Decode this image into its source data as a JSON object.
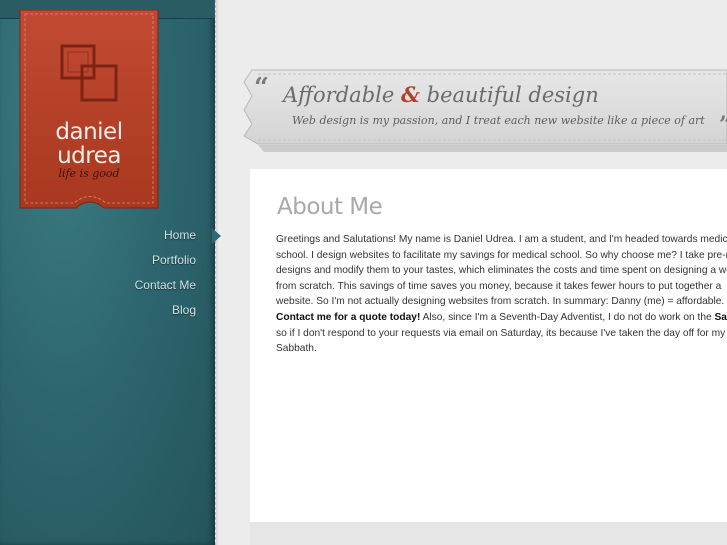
{
  "logo": {
    "name_line1": "daniel",
    "name_line2": "udrea",
    "tagline": "life is good",
    "ribbon_color": "#b9402a"
  },
  "nav": {
    "items": [
      {
        "label": "Home",
        "active": true
      },
      {
        "label": "Portfolio",
        "active": false
      },
      {
        "label": "Contact Me",
        "active": false
      },
      {
        "label": "Blog",
        "active": false
      }
    ]
  },
  "banner": {
    "open_quote": "“",
    "close_quote": "”",
    "title_part1": "Affordable",
    "title_amp": "&",
    "title_part2": "beautiful design",
    "subtitle": "Web design is my passion, and I treat each new website like a piece of art",
    "accent_color": "#b0412a"
  },
  "main": {
    "heading": "About Me",
    "lines": [
      [
        "Greetings and Salutations! My name is Daniel Udrea. I am a student, and I'm headed towards medical"
      ],
      [
        "school. I design websites to facilitate my savings for medical school. So why choose me? I take pre-made"
      ],
      [
        "designs and modify them to your tastes, which eliminates the costs and time spent on designing a website"
      ],
      [
        "from scratch. This savings of time saves you money, because it takes fewer hours to put together a"
      ],
      [
        "website. So  I'm not actually designing websites from scratch. In summary: Danny (me) = affordable."
      ],
      [
        "Contact me for a quote today!",
        " Also, since I'm a Seventh-Day Adventist, I do not do work on the ",
        "Sabbath",
        ","
      ],
      [
        "so if I don't respond to your requests via email on Saturday, its because I've taken the day off for my"
      ],
      [
        "Sabbath."
      ]
    ]
  }
}
